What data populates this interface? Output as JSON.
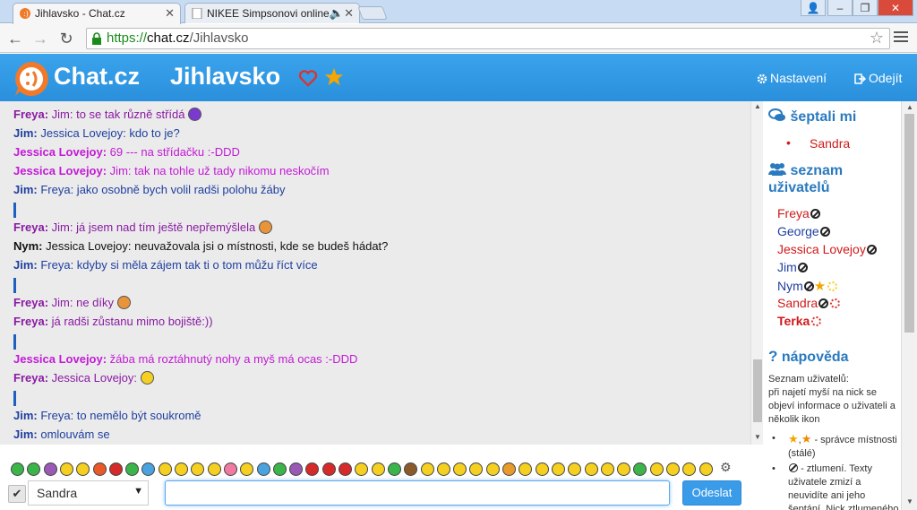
{
  "browser": {
    "tabs": [
      {
        "title": "Jihlavsko - Chat.cz",
        "active": true
      },
      {
        "title": "NIKEE Simpsonovi online",
        "active": false
      }
    ],
    "url_scheme": "https://",
    "url_host": "chat.cz",
    "url_path": "/Jihlavsko"
  },
  "header": {
    "brand": "Chat.cz",
    "room": "Jihlavsko",
    "settings_label": "Nastavení",
    "logout_label": "Odejít",
    "colors": {
      "bar": "#2a8fdc",
      "logo": "#f07a2a",
      "heart": "#e0312a",
      "star": "#f5a600"
    }
  },
  "chat": {
    "messages": [
      {
        "nick": "Freya:",
        "text": "Jim: to se tak různě střídá",
        "color": "#8a1aa3",
        "icon": "purple-smiley-icon"
      },
      {
        "nick": "Jim:",
        "text": "Jessica Lovejoy: kdo to je?",
        "color": "#1f3fa0"
      },
      {
        "nick": "Jessica Lovejoy:",
        "text": "69 --- na střídačku :-DDD",
        "color": "#c21ad6"
      },
      {
        "nick": "Jessica Lovejoy:",
        "text": "Jim: tak na tohle už tady nikomu neskočím",
        "color": "#c21ad6"
      },
      {
        "nick": "Jim:",
        "text": "Freya: jako osobně bych volil radši polohu žáby",
        "color": "#1f3fa0"
      },
      {
        "bar": true
      },
      {
        "nick": "Freya:",
        "text": "Jim: já jsem nad tím ještě nepřemýšlela",
        "color": "#8a1aa3",
        "icon": "grinning-smiley-icon"
      },
      {
        "nick": "Nym:",
        "text": "Jessica Lovejoy: neuvažovala jsi o místnosti, kde se budeš hádat?",
        "color": "#111111"
      },
      {
        "nick": "Jim:",
        "text": "Freya: kdyby si měla zájem tak ti o tom můžu říct více",
        "color": "#1f3fa0"
      },
      {
        "bar": true
      },
      {
        "nick": "Freya:",
        "text": "Jim: ne díky",
        "color": "#8a1aa3",
        "icon": "grinning-smiley-icon"
      },
      {
        "nick": "Freya:",
        "text": "já radši zůstanu mimo bojiště:))",
        "color": "#8a1aa3"
      },
      {
        "bar": true
      },
      {
        "nick": "Jessica Lovejoy:",
        "text": "žába má roztáhnutý nohy a myš má ocas :-DDD",
        "color": "#c21ad6"
      },
      {
        "nick": "Freya:",
        "text": "Jessica Lovejoy:",
        "color": "#8a1aa3",
        "icon": "surprised-smiley-icon"
      },
      {
        "bar": true
      },
      {
        "nick": "Jim:",
        "text": "Freya: to nemělo být soukromě",
        "color": "#1f3fa0"
      },
      {
        "nick": "Jim:",
        "text": "omlouvám se",
        "color": "#1f3fa0"
      }
    ]
  },
  "sidebar": {
    "whispered_title": "šeptali mi",
    "whispered": [
      {
        "name": "Sandra",
        "color": "#d01a1a"
      }
    ],
    "users_title": "seznam uživatelů",
    "users": [
      {
        "name": "Freya",
        "color": "#d01a1a",
        "bold": false,
        "icons": [
          "ban"
        ]
      },
      {
        "name": "George",
        "color": "#1f3fa0",
        "bold": false,
        "icons": [
          "ban"
        ]
      },
      {
        "name": "Jessica Lovejoy",
        "color": "#d01a1a",
        "bold": false,
        "icons": [
          "ban"
        ]
      },
      {
        "name": "Jim",
        "color": "#1f3fa0",
        "bold": false,
        "icons": [
          "ban"
        ]
      },
      {
        "name": "Nym",
        "color": "#1f3fa0",
        "bold": false,
        "icons": [
          "ban",
          "star",
          "sun-yellow"
        ]
      },
      {
        "name": "Sandra",
        "color": "#d01a1a",
        "bold": false,
        "icons": [
          "ban",
          "sun-red"
        ]
      },
      {
        "name": "Terka",
        "color": "#d01a1a",
        "bold": true,
        "icons": [
          "sun-red"
        ]
      }
    ],
    "help_title": "nápověda",
    "help_intro": "Seznam uživatelů:",
    "help_text": "při najetí myší na nick se objeví informace o uživateli a několik ikon",
    "help_items": [
      "- správce místnosti (stálé)",
      "- ztlumení. Texty uživatele zmizí a neuvidíte ani jeho šeptání. Nick ztlumeného uživatele"
    ]
  },
  "input": {
    "recipient": "Sandra",
    "message_value": "",
    "send_label": "Odeslat"
  },
  "emoticons": [
    "#3bb54a",
    "#3bb54a",
    "#9b59b6",
    "#f5d020",
    "#f5d020",
    "#e85a2a",
    "#d62a2a",
    "#3bb54a",
    "#4aa3df",
    "#f5d020",
    "#f5d020",
    "#f5d020",
    "#f5d020",
    "#f07aa0",
    "#f5d020",
    "#4aa3df",
    "#3bb54a",
    "#9b59b6",
    "#d62a2a",
    "#d62a2a",
    "#d62a2a",
    "#f5d020",
    "#f5d020",
    "#3bb54a",
    "#8b5a2b",
    "#f5d020",
    "#f5d020",
    "#f5d020",
    "#f5d020",
    "#f5d020",
    "#e89a2a",
    "#f5d020",
    "#f5d020",
    "#f5d020",
    "#f5d020",
    "#f5d020",
    "#f5d020",
    "#f5d020",
    "#3bb54a",
    "#f5d020",
    "#f5d020",
    "#f5d020",
    "#f5d020"
  ]
}
